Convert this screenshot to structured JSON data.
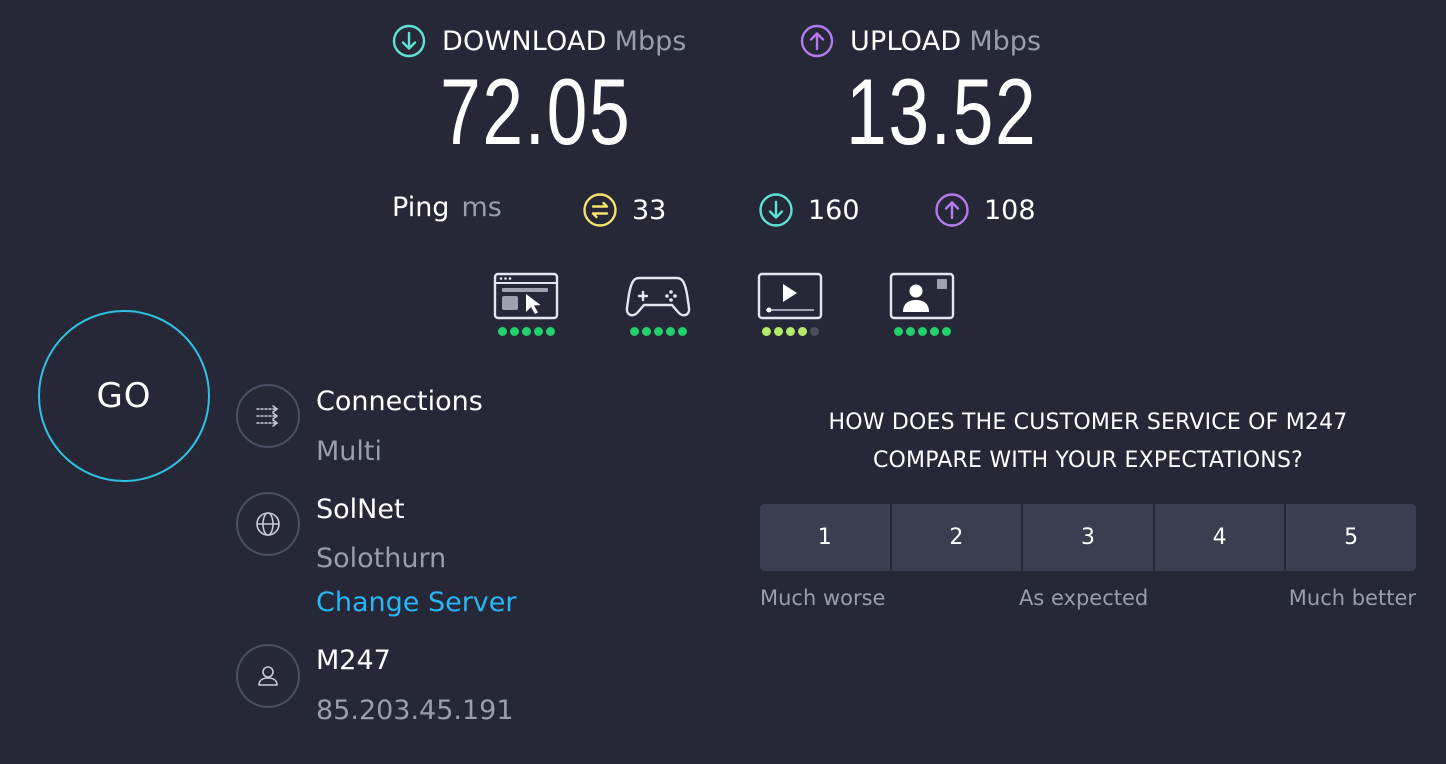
{
  "download": {
    "label": "DOWNLOAD",
    "unit": "Mbps",
    "value": "72.05",
    "icon": "arrow-down-circle-icon",
    "color": "#5ee3d4"
  },
  "upload": {
    "label": "UPLOAD",
    "unit": "Mbps",
    "value": "13.52",
    "icon": "arrow-up-circle-icon",
    "color": "#b57bee"
  },
  "ping": {
    "label": "Ping",
    "unit": "ms",
    "idle": {
      "value": "33",
      "icon": "ping-idle-icon",
      "color": "#f7e26b"
    },
    "download": {
      "value": "160",
      "icon": "arrow-down-circle-icon",
      "color": "#5ee3d4"
    },
    "upload": {
      "value": "108",
      "icon": "arrow-up-circle-icon",
      "color": "#b57bee"
    }
  },
  "quality": [
    {
      "icon": "web-browsing-icon",
      "rating": 5
    },
    {
      "icon": "gaming-controller-icon",
      "rating": 5
    },
    {
      "icon": "video-streaming-icon",
      "rating": 4
    },
    {
      "icon": "video-call-icon",
      "rating": 5
    }
  ],
  "go_button": {
    "label": "GO"
  },
  "connections": {
    "title": "Connections",
    "value": "Multi",
    "icon": "connections-icon"
  },
  "server": {
    "title": "SolNet",
    "location": "Solothurn",
    "change_label": "Change Server",
    "icon": "globe-icon"
  },
  "provider": {
    "title": "M247",
    "ip": "85.203.45.191",
    "icon": "user-icon"
  },
  "survey": {
    "question_line1": "HOW DOES THE CUSTOMER SERVICE OF M247",
    "question_line2": "COMPARE WITH YOUR EXPECTATIONS?",
    "options": [
      "1",
      "2",
      "3",
      "4",
      "5"
    ],
    "scale_low": "Much worse",
    "scale_mid": "As expected",
    "scale_high": "Much better"
  },
  "colors": {
    "background": "#262838",
    "accent_go": "#2fc1e3",
    "link": "#29b6f6",
    "good": "#22d16a"
  }
}
